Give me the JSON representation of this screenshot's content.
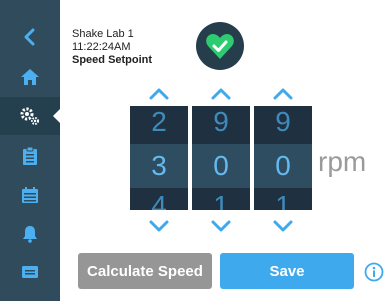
{
  "sidebar": {
    "items": [
      {
        "icon": "back-chevron-icon",
        "name": "sidebar-back"
      },
      {
        "icon": "home-icon",
        "name": "sidebar-home"
      },
      {
        "icon": "settings-gears-icon",
        "name": "sidebar-settings"
      },
      {
        "icon": "clipboard-icon",
        "name": "sidebar-clipboard"
      },
      {
        "icon": "calendar-icon",
        "name": "sidebar-calendar"
      },
      {
        "icon": "bell-icon",
        "name": "sidebar-alarms"
      },
      {
        "icon": "display-icon",
        "name": "sidebar-display"
      }
    ],
    "active_index": 2
  },
  "header": {
    "device_name": "Shake Lab 1",
    "time": "11:22:24AM",
    "page_title": "Speed Setpoint"
  },
  "status": {
    "icon": "heart-check-icon",
    "color": "#2ecc71"
  },
  "picker": {
    "digits": [
      {
        "prev": "2",
        "current": "3",
        "next": "4"
      },
      {
        "prev": "9",
        "current": "0",
        "next": "1"
      },
      {
        "prev": "9",
        "current": "0",
        "next": "1"
      }
    ],
    "unit": "rpm"
  },
  "actions": {
    "calculate_label": "Calculate Speed",
    "save_label": "Save"
  },
  "colors": {
    "sidebar": "#2f4b5c",
    "accent": "#3fa9ee",
    "wheel": "#1f3140"
  }
}
